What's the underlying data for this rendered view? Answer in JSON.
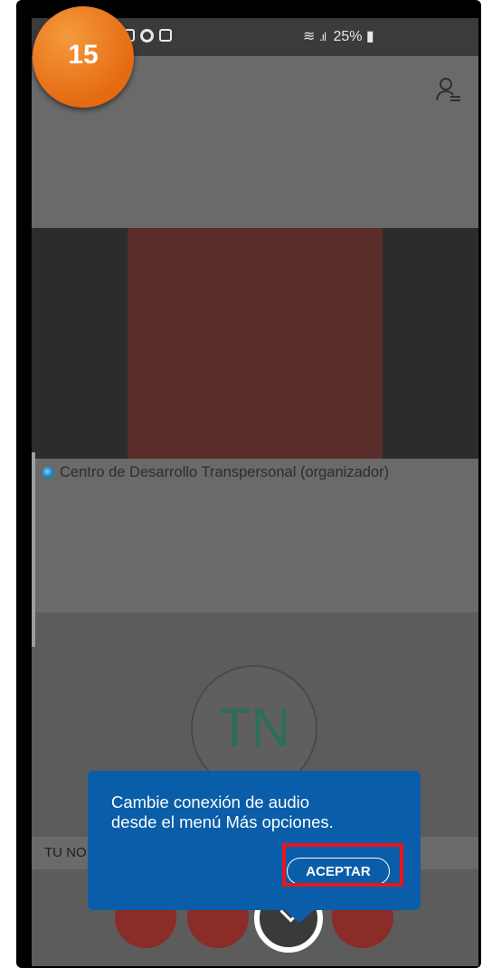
{
  "step_badge": "15",
  "status_bar": {
    "battery": "25%",
    "icons": [
      "gallery-icon",
      "sync-icon",
      "image-icon",
      "wifi-icon",
      "signal-icon",
      "battery-icon"
    ]
  },
  "presenter": {
    "name": "Centro de Desarrollo Transpersonal (organizador)"
  },
  "self": {
    "initials": "TN",
    "name_label": "TU NO"
  },
  "tooltip": {
    "message_line1": "Cambie conexión de audio",
    "message_line2": "desde el menú Más opciones.",
    "accept_label": "ACEPTAR"
  },
  "colors": {
    "tooltip_bg": "#0a5da8",
    "highlight": "#e8151c",
    "badge": "#e56a10",
    "control_red": "#8a2c28"
  }
}
